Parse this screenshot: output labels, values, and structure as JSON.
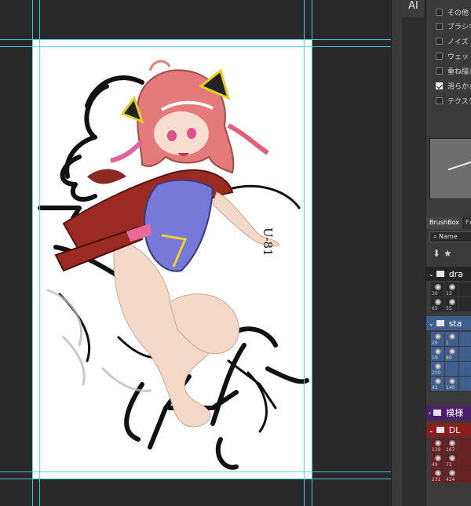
{
  "panel": {
    "ai_tab": "AI",
    "options": [
      {
        "label": "その他",
        "checked": false
      },
      {
        "label": "ブラシポーズ",
        "checked": false
      },
      {
        "label": "ノイズ",
        "checked": false
      },
      {
        "label": "ウェットエッジ",
        "checked": false
      },
      {
        "label": "重ね描き効果",
        "checked": false
      },
      {
        "label": "滑らかさ",
        "checked": true
      },
      {
        "label": "テクスチャを保護",
        "checked": false
      }
    ]
  },
  "brushbox": {
    "tabs": [
      "BrushBox",
      "Fx"
    ],
    "sort_label": "Name",
    "groups": [
      {
        "name": "dra",
        "sizes": [
          "30",
          "13",
          "",
          "65",
          "55",
          ""
        ]
      },
      {
        "name": "sta",
        "sizes": [
          "29",
          "1",
          "",
          "19",
          "80",
          "",
          "200",
          "",
          "",
          "42",
          "140",
          ""
        ]
      },
      {
        "name": "模様",
        "sizes": []
      },
      {
        "name": "DL",
        "sizes": [
          "139",
          "167",
          "",
          "49",
          "71",
          "",
          "231",
          "424",
          ""
        ]
      }
    ]
  },
  "canvas": {
    "sketch_text": "U-81"
  },
  "colors": {
    "guide": "#4fd6e6",
    "panel_bg": "#3a3a3a",
    "selected_group": "#3e5f8e",
    "red_group": "#8a1e1e"
  }
}
